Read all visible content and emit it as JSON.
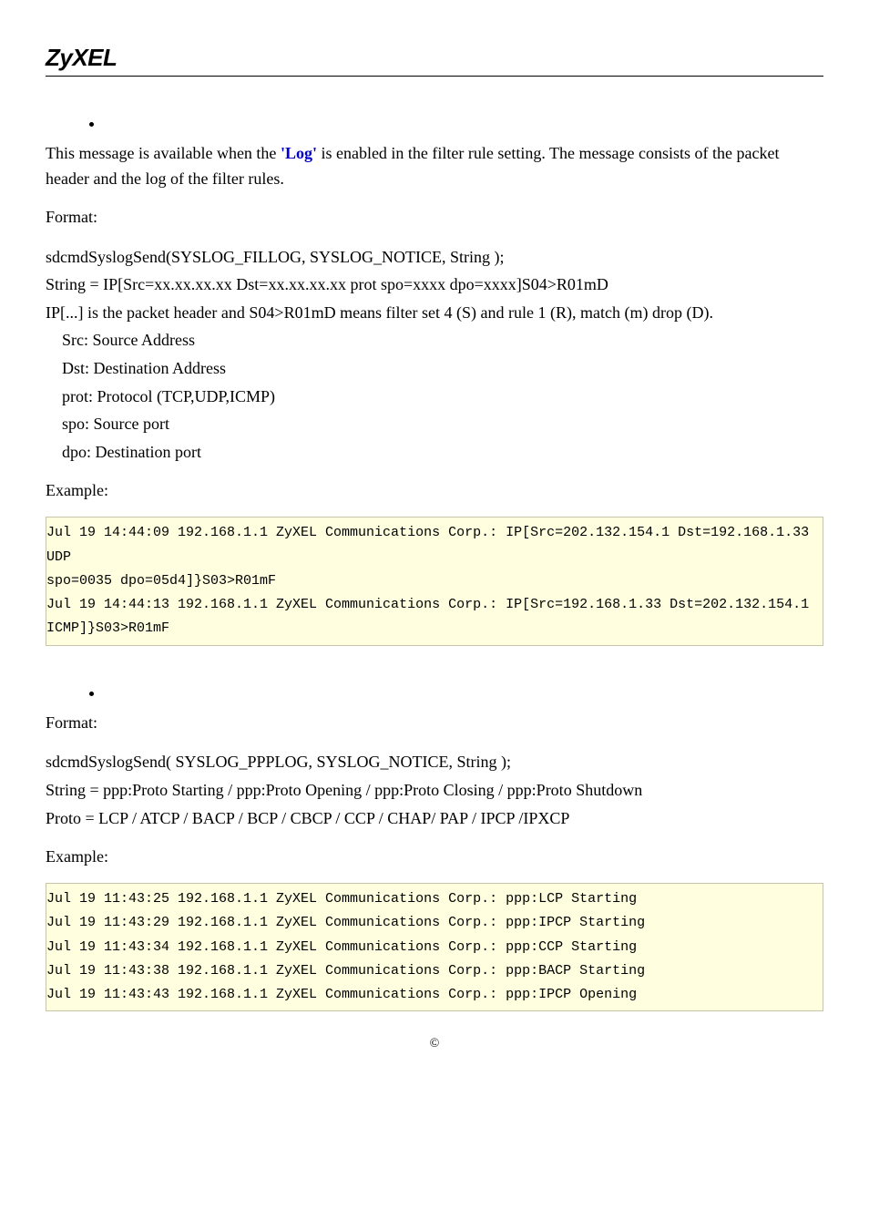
{
  "header": {
    "logo": "ZyXEL"
  },
  "section1": {
    "para": "This message is available when the ",
    "log_link": "'Log'",
    "para_cont": " is enabled in the filter rule setting. The message consists of the packet header and the log of the filter rules.",
    "format_label": "Format:",
    "fmt_line1": "sdcmdSyslogSend(SYSLOG_FILLOG, SYSLOG_NOTICE, String );",
    "fmt_line2": "String = IP[Src=xx.xx.xx.xx Dst=xx.xx.xx.xx prot spo=xxxx dpo=xxxx]S04>R01mD",
    "fmt_line3": "IP[...] is the packet header and S04>R01mD means filter set 4 (S) and rule 1 (R), match (m) drop (D).",
    "fmt_src": "Src: Source Address",
    "fmt_dst": "Dst: Destination Address",
    "fmt_prot": "prot: Protocol (TCP,UDP,ICMP)",
    "fmt_spo": "spo: Source port",
    "fmt_dpo": "dpo: Destination port",
    "example_label": "Example:",
    "ex1_l1": "Jul 19 14:44:09 192.168.1.1 ZyXEL Communications Corp.: IP[Src=202.132.154.1 Dst=192.168.1.33 UDP",
    "ex1_l2": "spo=0035  dpo=05d4]}S03>R01mF",
    "ex1_l3": "Jul 19 14:44:13 192.168.1.1 ZyXEL Communications Corp.: IP[Src=192.168.1.33 Dst=202.132.154.1",
    "ex1_l4": "ICMP]}S03>R01mF"
  },
  "section2": {
    "format_label": "Format:",
    "fmt_line1": "sdcmdSyslogSend( SYSLOG_PPPLOG, SYSLOG_NOTICE, String );",
    "fmt_line2": "String = ppp:Proto Starting / ppp:Proto Opening / ppp:Proto Closing / ppp:Proto Shutdown",
    "fmt_line3": "Proto = LCP / ATCP / BACP / BCP / CBCP / CCP / CHAP/ PAP / IPCP /IPXCP",
    "example_label": "Example:",
    "ex2_l1": "Jul 19 11:43:25 192.168.1.1 ZyXEL Communications Corp.: ppp:LCP Starting",
    "ex2_l2": "Jul 19 11:43:29 192.168.1.1 ZyXEL Communications Corp.: ppp:IPCP Starting",
    "ex2_l3": "Jul 19 11:43:34 192.168.1.1 ZyXEL Communications Corp.: ppp:CCP Starting",
    "ex2_l4": "Jul 19 11:43:38 192.168.1.1 ZyXEL Communications Corp.: ppp:BACP Starting",
    "ex2_l5": "Jul 19 11:43:43 192.168.1.1 ZyXEL Communications Corp.: ppp:IPCP Opening"
  },
  "footer": {
    "copyright": "©"
  }
}
